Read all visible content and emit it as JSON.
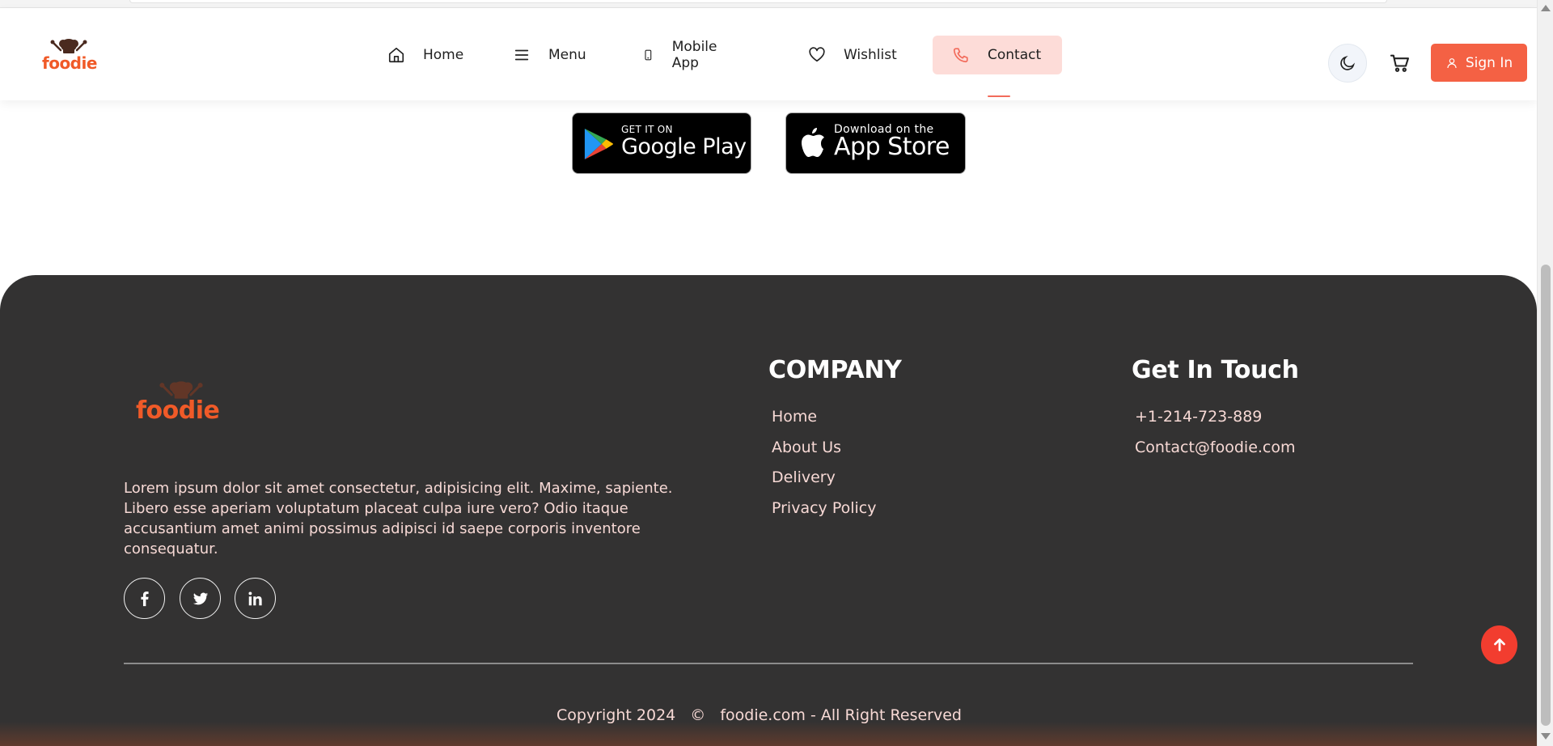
{
  "header": {
    "logo_text": "foodie",
    "nav": [
      {
        "label": "Home",
        "icon": "home-icon"
      },
      {
        "label": "Menu",
        "icon": "menu-icon"
      },
      {
        "label": "Mobile App",
        "icon": "phone-icon"
      },
      {
        "label": "Wishlist",
        "icon": "heart-icon"
      },
      {
        "label": "Contact",
        "icon": "call-icon",
        "active": true
      }
    ],
    "theme_icon": "moon-icon",
    "cart_icon": "cart-icon",
    "sign_in_label": "Sign In"
  },
  "badges": {
    "google_play": {
      "small": "GET IT ON",
      "big": "Google Play"
    },
    "app_store": {
      "small": "Download on the",
      "big": "App Store"
    }
  },
  "footer": {
    "logo_text": "foodie",
    "description": "Lorem ipsum dolor sit amet consectetur, adipisicing elit. Maxime, sapiente. Libero esse aperiam voluptatum placeat culpa iure vero? Odio itaque accusantium amet animi possimus adipisci id saepe corporis inventore consequatur.",
    "social": [
      {
        "name": "facebook-icon",
        "glyph": "f"
      },
      {
        "name": "twitter-icon",
        "glyph": "t"
      },
      {
        "name": "linkedin-icon",
        "glyph": "in"
      }
    ],
    "company": {
      "heading": "COMPANY",
      "links": [
        "Home",
        "About Us",
        "Delivery",
        "Privacy Policy"
      ]
    },
    "contact": {
      "heading": "Get In Touch",
      "phone": "+1-214-723-889",
      "email": "Contact@foodie.com"
    },
    "copyright": {
      "text": "Copyright 2024",
      "symbol": "©",
      "site": "foodie.com - All Right Reserved"
    }
  },
  "colors": {
    "accent": "#f46144",
    "active_bg": "#fddcd8",
    "footer_bg": "#333232",
    "footer_text": "#f7d9d5",
    "logo": "#f05a28",
    "scroll_top": "#f23d2f"
  }
}
